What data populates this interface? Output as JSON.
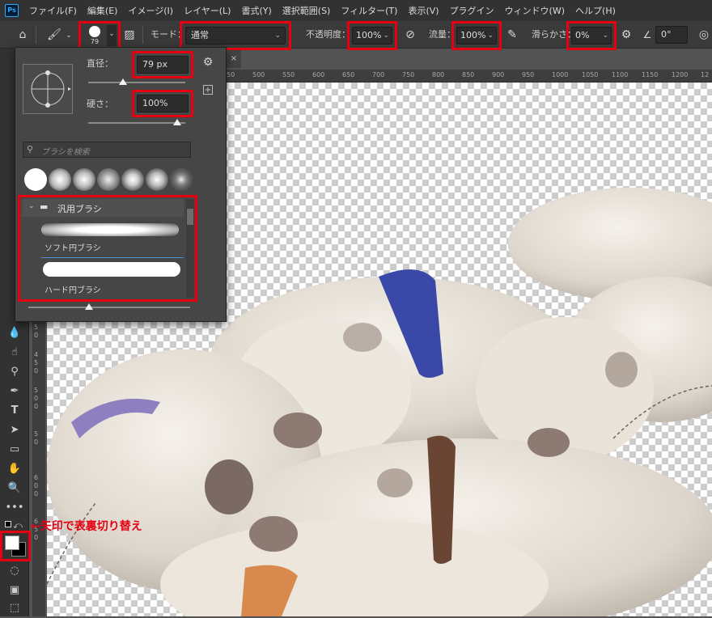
{
  "menubar": {
    "logo": "Ps",
    "items": [
      "ファイル(F)",
      "編集(E)",
      "イメージ(I)",
      "レイヤー(L)",
      "書式(Y)",
      "選択範囲(S)",
      "フィルター(T)",
      "表示(V)",
      "プラグイン",
      "ウィンドウ(W)",
      "ヘルプ(H)"
    ]
  },
  "options": {
    "brush_size": "79",
    "mode_label": "モード：",
    "mode_value": "通常",
    "opacity_label": "不透明度：",
    "opacity_value": "100%",
    "flow_label": "流量：",
    "flow_value": "100%",
    "smoothing_label": "滑らかさ：",
    "smoothing_value": "0%",
    "angle_value": "0°"
  },
  "brush_panel": {
    "size_label": "直径：",
    "size_value": "79 px",
    "size_fraction": 0.36,
    "hardness_label": "硬さ：",
    "hardness_value": "100%",
    "hardness_fraction": 1.0,
    "search_placeholder": "ブラシを検索",
    "folder_name": "汎用ブラシ",
    "preset_1": "ソフト円ブラシ",
    "preset_2": "ハード円ブラシ"
  },
  "ruler": {
    "top": [
      "50",
      "500",
      "550",
      "600",
      "650",
      "700",
      "750",
      "800",
      "850",
      "900",
      "950",
      "1000",
      "1050",
      "1100",
      "1150",
      "1200",
      "12"
    ],
    "left": [
      "5",
      "0",
      "4",
      "5",
      "0",
      "5",
      "0",
      "0",
      "5",
      "0",
      "6",
      "0",
      "0",
      "6",
      "5",
      "0"
    ]
  },
  "annotation": "←矢印で表裏切り替え",
  "colors": {
    "highlight": "#e60012",
    "foreground": "#ffffff",
    "background": "#000000"
  }
}
